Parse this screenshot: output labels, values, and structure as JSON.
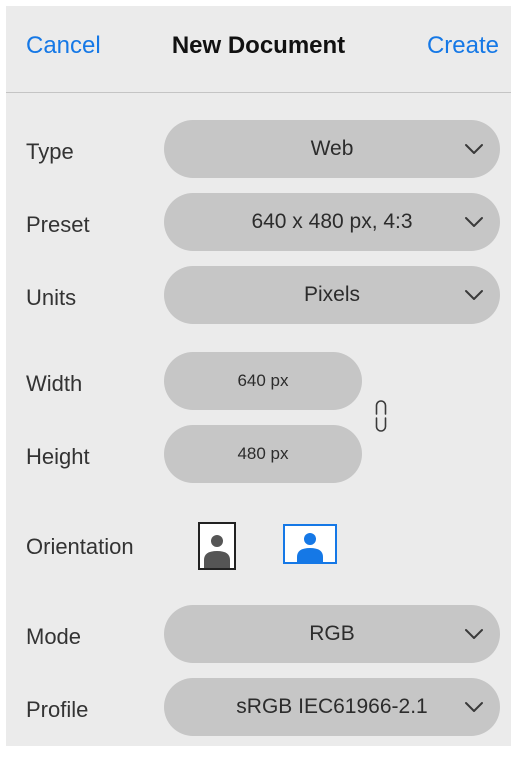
{
  "header": {
    "cancel_label": "Cancel",
    "title": "New Document",
    "create_label": "Create"
  },
  "fields": {
    "type": {
      "label": "Type",
      "value": "Web"
    },
    "preset": {
      "label": "Preset",
      "value": "640 x 480 px, 4:3"
    },
    "units": {
      "label": "Units",
      "value": "Pixels"
    },
    "width": {
      "label": "Width",
      "value": "640 px"
    },
    "height": {
      "label": "Height",
      "value": "480 px"
    },
    "orientation": {
      "label": "Orientation",
      "selected": "landscape"
    },
    "mode": {
      "label": "Mode",
      "value": "RGB"
    },
    "profile": {
      "label": "Profile",
      "value": "sRGB IEC61966-2.1"
    }
  },
  "icons": {
    "dropdown": "chevron-down-icon",
    "link": "chain-link-icon",
    "portrait": "portrait-orientation-icon",
    "landscape": "landscape-orientation-icon"
  },
  "colors": {
    "accent": "#1578e6",
    "panel_background": "#ebebeb",
    "control_background": "#c6c6c6",
    "text": "#333333"
  }
}
